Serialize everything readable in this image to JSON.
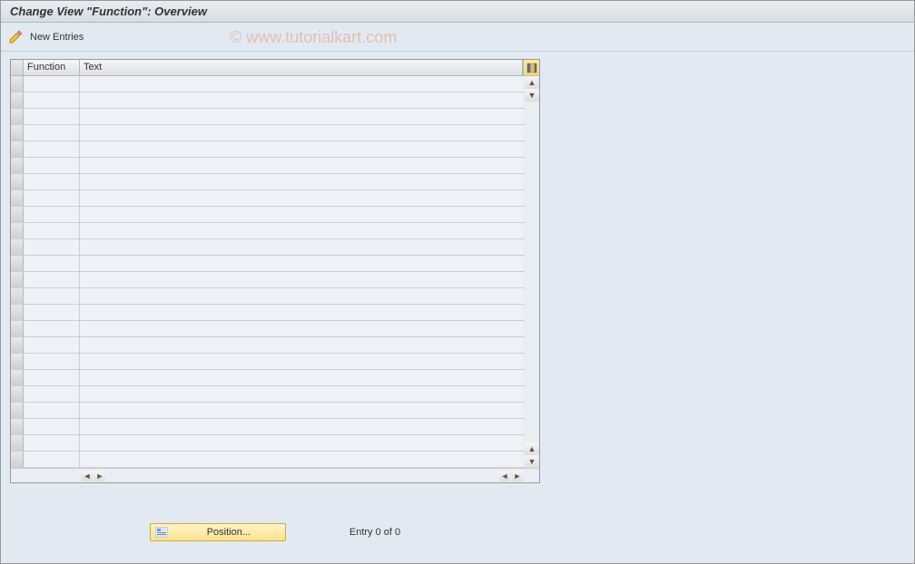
{
  "title": "Change View \"Function\": Overview",
  "watermark": "© www.tutorialkart.com",
  "toolbar": {
    "new_entries_label": "New Entries"
  },
  "table": {
    "columns": {
      "function": "Function",
      "text": "Text"
    },
    "row_count": 24,
    "rows": []
  },
  "footer": {
    "position_label": "Position...",
    "entry_status": "Entry 0 of 0"
  }
}
